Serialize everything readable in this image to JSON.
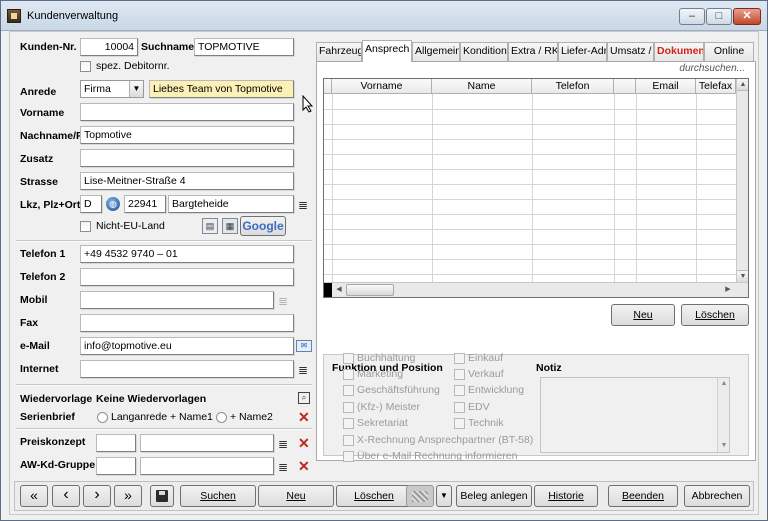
{
  "window": {
    "title": "Kundenverwaltung"
  },
  "left": {
    "kundennr_label": "Kunden-Nr.",
    "kundennr_value": "10004",
    "suchname_label": "Suchname",
    "suchname_value": "TOPMOTIVE",
    "debitor_label": "spez. Debitornr.",
    "anrede_label": "Anrede",
    "anrede_value": "Firma",
    "briefanrede_value": "Liebes Team von Topmotive",
    "vorname_label": "Vorname",
    "vorname_value": "",
    "nachname_label": "Nachname/F",
    "nachname_value": "Topmotive",
    "zusatz_label": "Zusatz",
    "zusatz_value": "",
    "strasse_label": "Strasse",
    "strasse_value": "Lise-Meitner-Straße 4",
    "ort_label": "Lkz, Plz+Ort",
    "lkz_value": "D",
    "plz_value": "22941",
    "ort_value": "Bargteheide",
    "google_label": "Google",
    "nicht_eu_label": "Nicht-EU-Land",
    "telefon1_label": "Telefon 1",
    "telefon1_value": "+49 4532 9740 – 01",
    "telefon2_label": "Telefon 2",
    "telefon2_value": "",
    "mobil_label": "Mobil",
    "mobil_value": "",
    "fax_label": "Fax",
    "fax_value": "",
    "email_label": "e-Mail",
    "email_value": "info@topmotive.eu",
    "internet_label": "Internet",
    "internet_value": "",
    "wiedervorlage_label": "Wiedervorlage",
    "wiedervorlage_value": "Keine Wiedervorlagen",
    "serienbrief_label": "Serienbrief",
    "radio1_label": "Langanrede + Name1",
    "radio2_label": "+ Name2",
    "preiskonzept_label": "Preiskonzept",
    "awgruppe_label": "AW-Kd-Gruppe"
  },
  "tabs": [
    "Fahrzeuge",
    "Ansprech",
    "Allgemein",
    "Konditionen",
    "Extra / RK",
    "Liefer-Adr",
    "Umsatz / I",
    "Dokumente",
    "Online"
  ],
  "contacts": {
    "search_placeholder": "durchsuchen...",
    "columns": [
      "Vorname",
      "Name",
      "Telefon",
      "",
      "Email",
      "Telefax"
    ],
    "neu_label": "Neu",
    "loeschen_label": "Löschen"
  },
  "funktion": {
    "title": "Funktion und Position",
    "notiz_label": "Notiz",
    "left_items": [
      "Buchhaltung",
      "Marketing",
      "Geschäftsführung",
      "(Kfz-) Meister",
      "Sekretariat"
    ],
    "right_items": [
      "Einkauf",
      "Verkauf",
      "Entwicklung",
      "EDV",
      "Technik"
    ],
    "wide_items": [
      "X-Rechnung Ansprechpartner (BT-58)",
      "Über e-Mail Rechnung informieren"
    ]
  },
  "toolbar": {
    "first": "«",
    "prev": "‹",
    "next": "›",
    "last": "»",
    "suchen": "Suchen",
    "neu": "Neu",
    "loeschen": "Löschen",
    "beleg": "Beleg anlegen",
    "historie": "Historie",
    "beenden": "Beenden",
    "abbrechen": "Abbrechen"
  }
}
